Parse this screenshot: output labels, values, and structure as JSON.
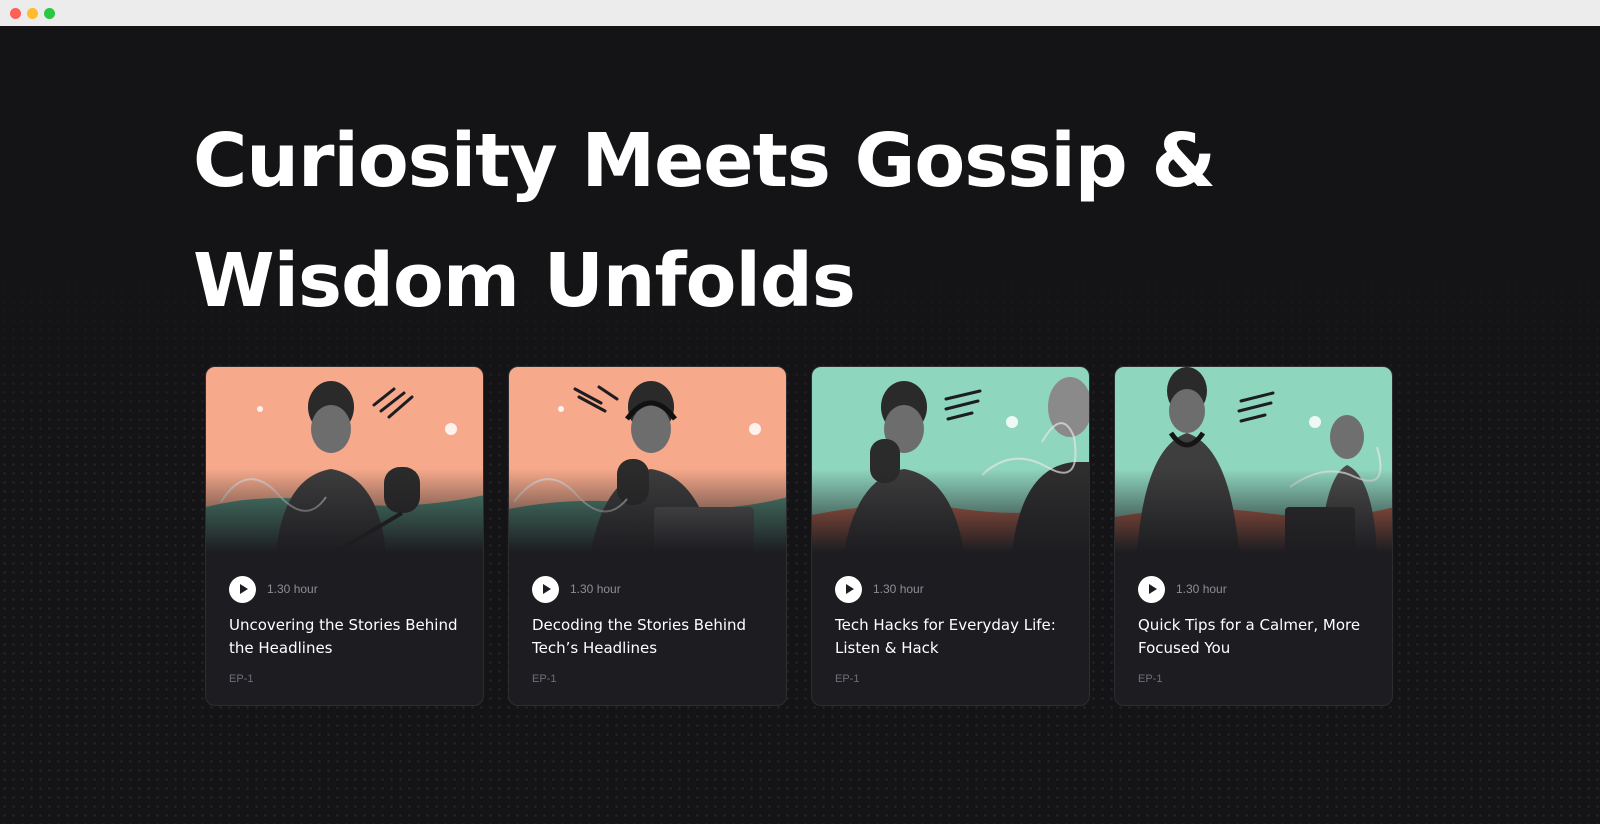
{
  "headline": "Curiosity Meets Gossip & Wisdom Unfolds",
  "colors": {
    "page_background": "#141416",
    "card_background": "#1d1d21",
    "peach": "#f6a98b",
    "mint": "#8fd6bf",
    "text_primary": "#ffffff",
    "text_secondary": "#8d8d96"
  },
  "episodes": [
    {
      "thumbnail_theme": "peach",
      "play_icon": "play-icon",
      "duration": "1.30 hour",
      "title": "Uncovering the Stories Behind the Headlines",
      "episode": "EP-1"
    },
    {
      "thumbnail_theme": "peach",
      "play_icon": "play-icon",
      "duration": "1.30 hour",
      "title": "Decoding the Stories Behind Tech’s Headlines",
      "episode": "EP-1"
    },
    {
      "thumbnail_theme": "mint",
      "play_icon": "play-icon",
      "duration": "1.30 hour",
      "title": "Tech Hacks for Everyday Life: Listen & Hack",
      "episode": "EP-1"
    },
    {
      "thumbnail_theme": "mint",
      "play_icon": "play-icon",
      "duration": "1.30 hour",
      "title": "Quick Tips for a Calmer, More Focused You",
      "episode": "EP-1"
    }
  ]
}
